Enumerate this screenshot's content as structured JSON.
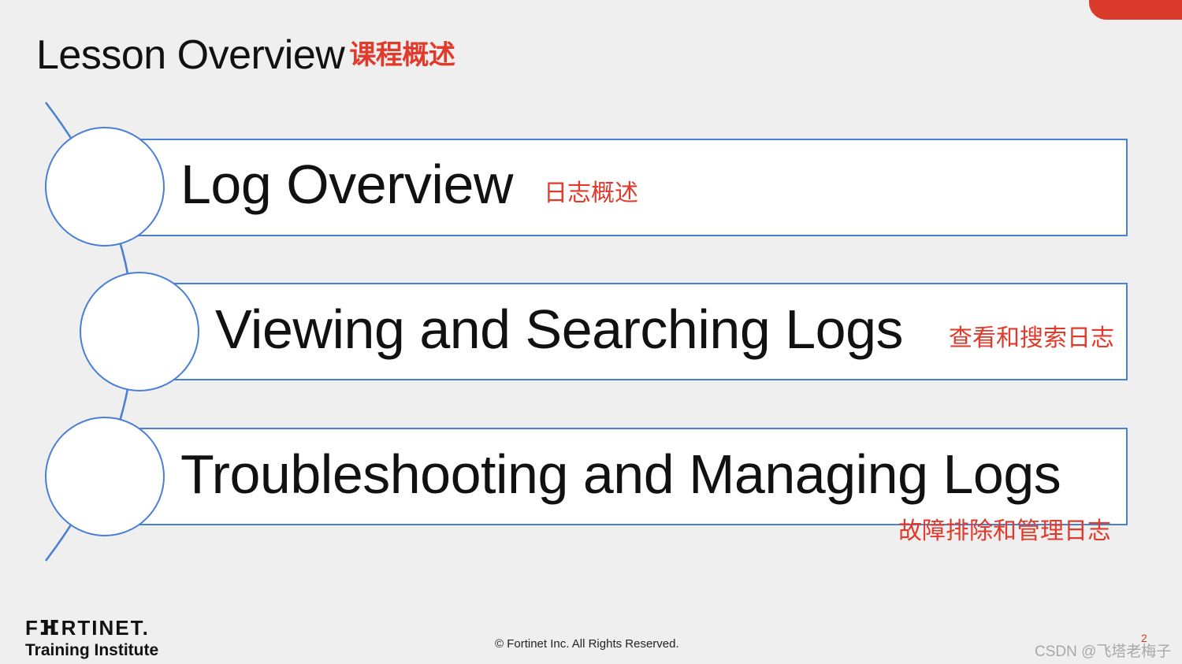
{
  "slide": {
    "title": "Lesson Overview",
    "title_cn": "课程概述"
  },
  "items": [
    {
      "label": "Log Overview",
      "label_cn": "日志概述"
    },
    {
      "label": "Viewing and Searching Logs",
      "label_cn": "查看和搜索日志"
    },
    {
      "label": "Troubleshooting and Managing Logs",
      "label_cn": "故障排除和管理日志"
    }
  ],
  "footer": {
    "logo": "FⴼRTINET.",
    "logo_sub": "Training Institute",
    "copyright": "© Fortinet Inc. All Rights Reserved.",
    "page_number": "2",
    "watermark": "CSDN @飞塔老梅子"
  },
  "colors": {
    "accent": "#e23a2a",
    "outline": "#4a7fd6",
    "corner_tab": "#d93a2b"
  }
}
